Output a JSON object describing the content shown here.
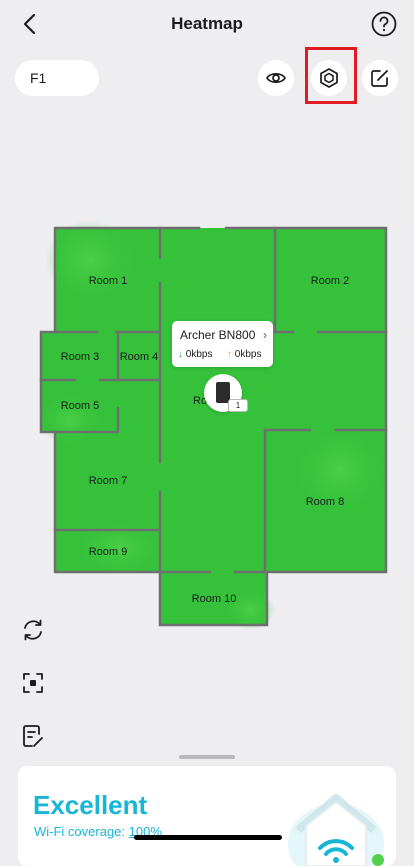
{
  "header": {
    "title": "Heatmap"
  },
  "floor": {
    "selected": "F1"
  },
  "rooms": [
    "Room 1",
    "Room 2",
    "Room 3",
    "Room 4",
    "Ro",
    "Room 5",
    "Room 7",
    "Room 8",
    "Room 9",
    "Room 10"
  ],
  "device_popup": {
    "name": "Archer BN800",
    "download": "0kbps",
    "upload": "0kbps",
    "badge": "1"
  },
  "summary": {
    "quality": "Excellent",
    "coverage_label": "Wi-Fi coverage:",
    "coverage_value": "100%"
  },
  "colors": {
    "signal_excellent": "#39c53c",
    "accent": "#19b5d6",
    "highlight": "#e01b24"
  },
  "icons": {
    "back": "chevron-left-icon",
    "help": "question-circle-icon",
    "visibility": "eye-icon",
    "settings": "hexagon-settings-icon",
    "edit": "edit-square-icon",
    "refresh": "refresh-icon",
    "focus": "scan-focus-icon",
    "notes": "checklist-edit-icon"
  }
}
